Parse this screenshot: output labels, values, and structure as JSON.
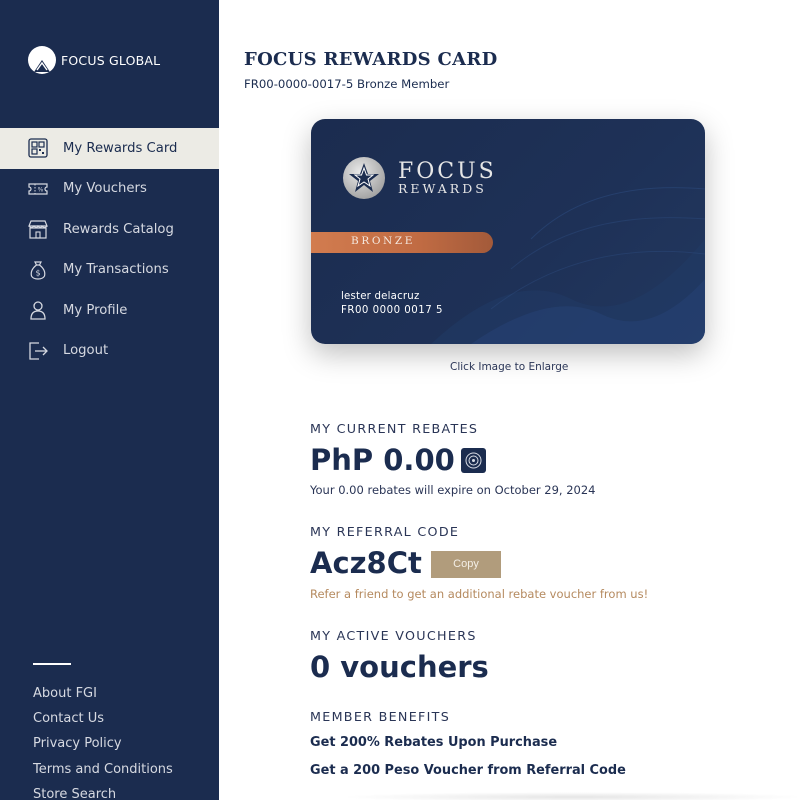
{
  "brand": {
    "name": "FOCUS GLOBAL",
    "logo_icon": "mountain-logo-icon"
  },
  "sidebar": {
    "items": [
      {
        "label": "My Rewards Card",
        "icon": "qr-card-icon",
        "active": true
      },
      {
        "label": "My Vouchers",
        "icon": "voucher-ticket-icon",
        "active": false
      },
      {
        "label": "Rewards Catalog",
        "icon": "storefront-icon",
        "active": false
      },
      {
        "label": "My Transactions",
        "icon": "money-bag-icon",
        "active": false
      },
      {
        "label": "My Profile",
        "icon": "user-icon",
        "active": false
      },
      {
        "label": "Logout",
        "icon": "logout-icon",
        "active": false
      }
    ],
    "footer_links": [
      "About FGI",
      "Contact Us",
      "Privacy Policy",
      "Terms and Conditions",
      "Store Search"
    ]
  },
  "main": {
    "title": "FOCUS REWARDS CARD",
    "subtitle": "FR00-0000-0017-5 Bronze Member",
    "card": {
      "brand_line1": "FOCUS",
      "brand_line2": "REWARDS",
      "tier": "BRONZE",
      "holder_name": "lester delacruz",
      "card_number": "FR00 0000 0017 5",
      "tier_color": "#c8734a",
      "card_color": "#1b2c4f"
    },
    "enlarge_hint": "Click Image to Enlarge",
    "rebates": {
      "label": "MY CURRENT REBATES",
      "value": "PhP 0.00",
      "note": "Your 0.00 rebates will expire on October 29, 2024",
      "icon": "info-circle-icon"
    },
    "referral": {
      "label": "MY REFERRAL CODE",
      "code": "Acz8Ct",
      "copy_label": "Copy",
      "note": "Refer a friend to get an additional rebate voucher from us!"
    },
    "vouchers": {
      "label": "MY ACTIVE VOUCHERS",
      "value": "0 vouchers"
    },
    "benefits": {
      "label": "MEMBER BENEFITS",
      "items": [
        "Get 200% Rebates Upon Purchase",
        "Get a 200 Peso Voucher from Referral Code"
      ]
    }
  },
  "colors": {
    "sidebar_bg": "#1b2c4f",
    "active_item_bg": "#ecebe5",
    "copy_button": "#b19c7c",
    "referral_note": "#b58a5f"
  }
}
